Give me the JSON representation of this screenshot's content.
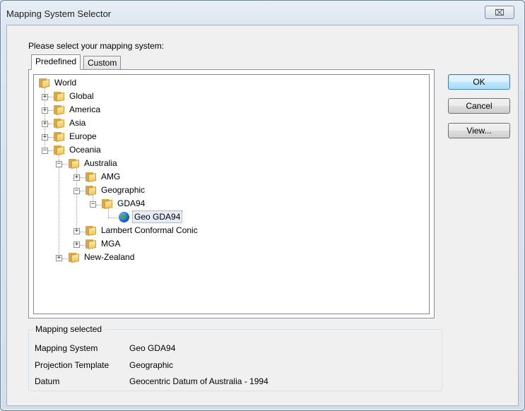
{
  "window": {
    "title": "Mapping System Selector",
    "close_symbol": "⌧"
  },
  "prompt": "Please select your mapping system:",
  "tabs": [
    {
      "label": "Predefined",
      "active": true
    },
    {
      "label": "Custom",
      "active": false
    }
  ],
  "tree": {
    "nodes": [
      {
        "label": "World",
        "icon": "folder-icon",
        "expander": "",
        "selected": false
      },
      {
        "label": "Global",
        "icon": "folder-icon",
        "expander": "+",
        "selected": false
      },
      {
        "label": "America",
        "icon": "folder-icon",
        "expander": "+",
        "selected": false
      },
      {
        "label": "Asia",
        "icon": "folder-icon",
        "expander": "+",
        "selected": false
      },
      {
        "label": "Europe",
        "icon": "folder-icon",
        "expander": "+",
        "selected": false
      },
      {
        "label": "Oceania",
        "icon": "folder-icon",
        "expander": "−",
        "selected": false
      },
      {
        "label": "Australia",
        "icon": "folder-icon",
        "expander": "−",
        "selected": false
      },
      {
        "label": "AMG",
        "icon": "folder-icon",
        "expander": "+",
        "selected": false
      },
      {
        "label": "Geographic",
        "icon": "folder-icon",
        "expander": "−",
        "selected": false
      },
      {
        "label": "GDA94",
        "icon": "folder-icon",
        "expander": "−",
        "selected": false
      },
      {
        "label": "Geo GDA94",
        "icon": "globe-icon",
        "expander": "",
        "selected": true
      },
      {
        "label": "Lambert Conformal Conic",
        "icon": "folder-icon",
        "expander": "+",
        "selected": false
      },
      {
        "label": "MGA",
        "icon": "folder-icon",
        "expander": "+",
        "selected": false
      },
      {
        "label": "New-Zealand",
        "icon": "folder-icon",
        "expander": "+",
        "selected": false
      }
    ]
  },
  "buttons": {
    "ok": "OK",
    "cancel": "Cancel",
    "view": "View..."
  },
  "mapping_selected": {
    "title": "Mapping selected",
    "rows": [
      {
        "label": "Mapping System",
        "value": "Geo GDA94"
      },
      {
        "label": "Projection Template",
        "value": "Geographic"
      },
      {
        "label": "Datum",
        "value": "Geocentric Datum of Australia - 1994"
      }
    ]
  },
  "colors": {
    "selection_bg": "#e5ecf6",
    "default_button_border": "#3c7fb1",
    "folder_yellow": "#f0c861"
  }
}
